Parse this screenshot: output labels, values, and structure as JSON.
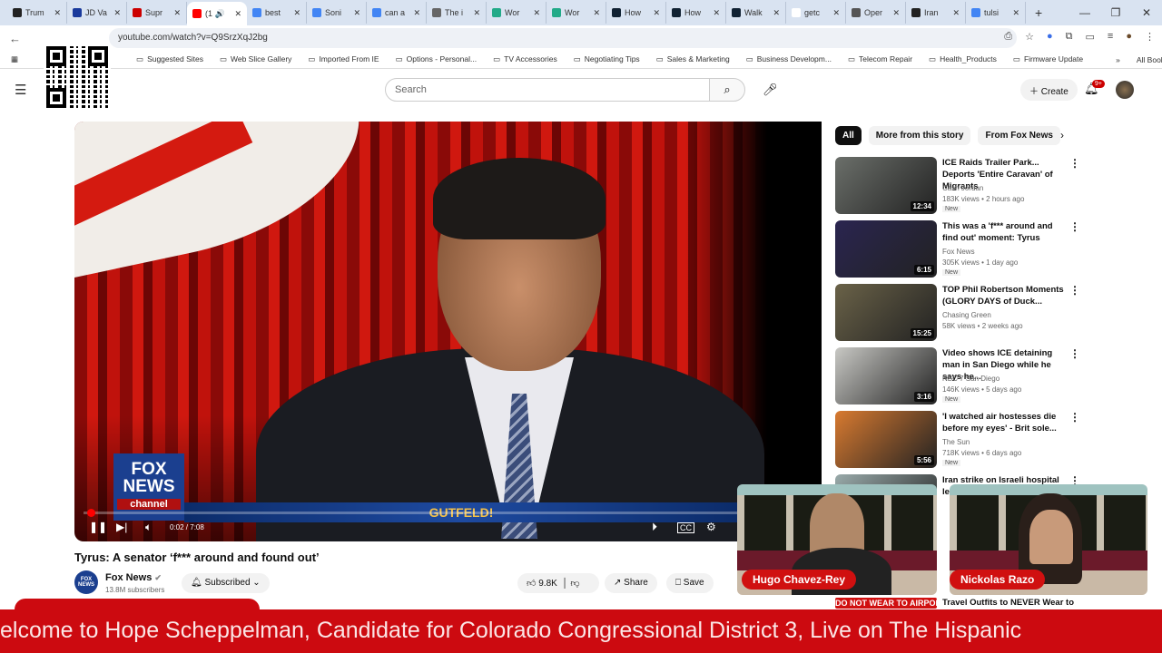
{
  "browser": {
    "tabs": [
      {
        "label": "Trum",
        "color": "#222"
      },
      {
        "label": "JD Va",
        "color": "#1a3a9c"
      },
      {
        "label": "Supr",
        "color": "#c00"
      },
      {
        "label": "(1 🔊",
        "color": "#f00",
        "active": true
      },
      {
        "label": "best",
        "color": "#4285f4"
      },
      {
        "label": "Soni",
        "color": "#4285f4"
      },
      {
        "label": "can a",
        "color": "#4285f4"
      },
      {
        "label": "The i",
        "color": "#666"
      },
      {
        "label": "Wor",
        "color": "#2a8"
      },
      {
        "label": "Wor",
        "color": "#2a8"
      },
      {
        "label": "How",
        "color": "#123"
      },
      {
        "label": "How",
        "color": "#123"
      },
      {
        "label": "Walk",
        "color": "#123"
      },
      {
        "label": "getc",
        "color": "#fff"
      },
      {
        "label": "Oper",
        "color": "#555"
      },
      {
        "label": "Iran",
        "color": "#222"
      },
      {
        "label": "tulsi",
        "color": "#4285f4"
      }
    ],
    "url": "youtube.com/watch?v=Q9SrzXqJ2bg",
    "bookmarks": [
      "Suggested Sites",
      "Web Slice Gallery",
      "Imported From IE",
      "Options - Personal...",
      "TV Accessories",
      "Negotiating Tips",
      "Sales & Marketing",
      "Business Developm...",
      "Telecom Repair",
      "Health_Products",
      "Firmware Update"
    ],
    "all_bookmarks": "All Bookmarks"
  },
  "youtube": {
    "search_placeholder": "Search",
    "create": "Create",
    "notif_badge": "9+",
    "video": {
      "lower_third": "GUTFELD!",
      "logo_text": "FOX NEWS",
      "logo_sub": "channel",
      "time": "0:02 / 7:08",
      "progress_fraction": 0.005,
      "title": "Tyrus: A senator ‘f*** around and found out’",
      "channel": "Fox News",
      "subscribers": "13.8M subscribers",
      "subscribed": "Subscribed",
      "likes": "9.8K",
      "share": "Share",
      "save": "Save"
    },
    "chips": [
      "All",
      "More from this story",
      "From Fox News"
    ],
    "recommendations": [
      {
        "title": "ICE Raids Trailer Park... Deports 'Entire Caravan' of Migrants",
        "channel": "Cash Jordan",
        "meta": "183K views • 2 hours ago",
        "badge": "New",
        "duration": "12:34",
        "thumb_color": "#6b6f6a"
      },
      {
        "title": "This was a 'f*** around and find out' moment: Tyrus",
        "channel": "Fox News",
        "meta": "305K views • 1 day ago",
        "badge": "New",
        "duration": "6:15",
        "thumb_color": "#2a2550"
      },
      {
        "title": "TOP Phil Robertson Moments (GLORY DAYS of Duck...",
        "channel": "Chasing Green",
        "meta": "58K views • 2 weeks ago",
        "badge": "",
        "duration": "15:25",
        "thumb_color": "#6a6248"
      },
      {
        "title": "Video shows ICE detaining man in San Diego while he says he...",
        "channel": "NBC 7 San Diego",
        "meta": "146K views • 5 days ago",
        "badge": "New",
        "duration": "3:16",
        "thumb_color": "#c8c8c4"
      },
      {
        "title": "'I watched air hostesses die before my eyes' - Brit sole...",
        "channel": "The Sun",
        "meta": "718K views • 6 days ago",
        "badge": "New",
        "duration": "5:56",
        "thumb_color": "#d87a30"
      },
      {
        "title": "Iran strike on Israeli hospital le...",
        "channel": "",
        "meta": "",
        "badge": "",
        "duration": "",
        "thumb_color": "#9aa"
      }
    ],
    "partial_rec": {
      "title": "Travel Outfits to NEVER Wear to",
      "thumb_text": "DO NOT WEAR TO AIRPORT"
    }
  },
  "overlay": {
    "guests": [
      "Hugo Chavez-Rey",
      "Nickolas Razo"
    ],
    "ticker": "elcome to Hope Scheppelman, Candidate for Colorado Congressional  District 3, Live on The Hispanic"
  }
}
